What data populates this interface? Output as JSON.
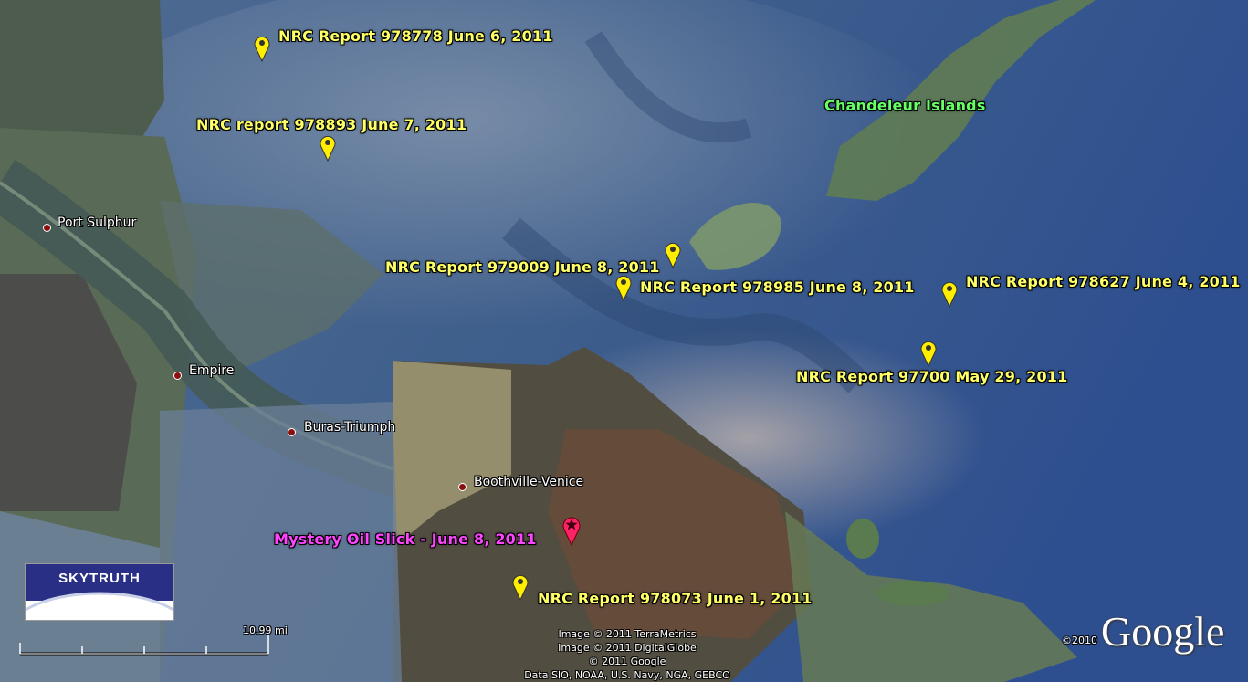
{
  "colors": {
    "pin_yellow": "#ffee00",
    "pin_red": "#ff2266",
    "label_yellow": "#ffff66",
    "label_green": "#66ff66",
    "label_magenta": "#ff44ff"
  },
  "markers": {
    "nrc_978778": {
      "label": "NRC Report 978778 June 6, 2011",
      "icon": "map-pin-icon"
    },
    "nrc_978893": {
      "label": "NRC report 978893 June 7, 2011",
      "icon": "map-pin-icon"
    },
    "nrc_979009": {
      "label": "NRC Report 979009 June 8, 2011",
      "icon": "map-pin-icon"
    },
    "nrc_978985": {
      "label": "NRC Report 978985 June 8, 2011",
      "icon": "map-pin-icon"
    },
    "nrc_978627": {
      "label": "NRC Report 978627 June 4, 2011",
      "icon": "map-pin-icon"
    },
    "nrc_97700": {
      "label": "NRC Report 97700 May 29, 2011",
      "icon": "map-pin-icon"
    },
    "nrc_978073": {
      "label": "NRC Report 978073 June 1, 2011",
      "icon": "map-pin-icon"
    },
    "mystery": {
      "label": "Mystery Oil Slick - June 8, 2011",
      "icon": "star-pin-icon"
    }
  },
  "places": {
    "chandeleur": "Chandeleur Islands",
    "port_sulphur": "Port Sulphur",
    "empire": "Empire",
    "buras": "Buras-Triumph",
    "boothville": "Boothville-Venice"
  },
  "logo": {
    "text": "SKYTRUTH"
  },
  "scale": {
    "label": "10.99 mi"
  },
  "credits": {
    "line1": "Image © 2011 TerraMetrics",
    "line2": "Image © 2011 DigitalGlobe",
    "line3": "© 2011 Google",
    "line4": "Data SIO, NOAA, U.S. Navy, NGA, GEBCO"
  },
  "brand": {
    "copyright": "©2010",
    "name": "Google"
  }
}
